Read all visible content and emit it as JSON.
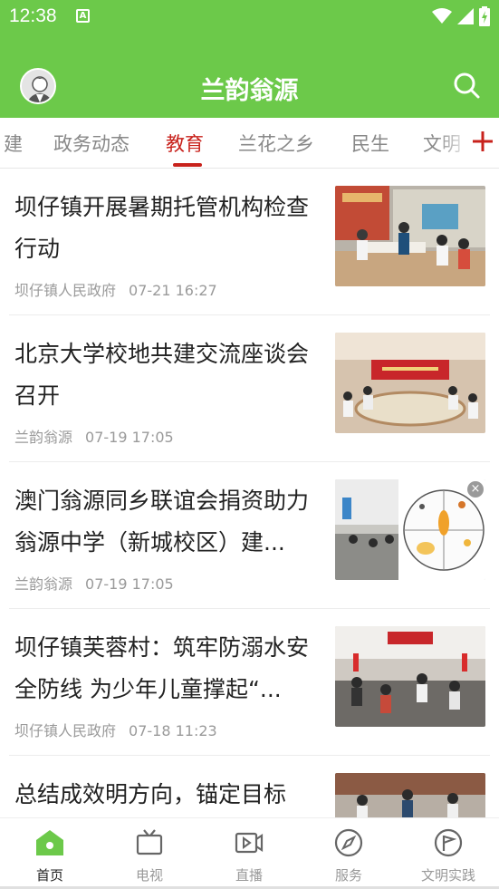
{
  "status": {
    "time": "12:38",
    "indicator": "A"
  },
  "header": {
    "title": "兰韵翁源"
  },
  "tabs": [
    {
      "label": "建"
    },
    {
      "label": "政务动态"
    },
    {
      "label": "教育",
      "active": true
    },
    {
      "label": "兰花之乡"
    },
    {
      "label": "民生"
    },
    {
      "label": "文明"
    }
  ],
  "feed": [
    {
      "title": "坝仔镇开展暑期托管机构检查行动",
      "source": "坝仔镇人民政府",
      "time": "07-21 16:27"
    },
    {
      "title": "北京大学校地共建交流座谈会召开",
      "source": "兰韵翁源",
      "time": "07-19 17:05"
    },
    {
      "title": "澳门翁源同乡联谊会捐资助力翁源中学（新城校区）建...",
      "source": "兰韵翁源",
      "time": "07-19 17:05"
    },
    {
      "title": "坝仔镇芙蓉村：筑牢防溺水安全防线 为少年儿童撑起“...",
      "source": "坝仔镇人民政府",
      "time": "07-18 11:23"
    },
    {
      "title": "总结成效明方向，锚定目标",
      "source": "",
      "time": ""
    }
  ],
  "bottom_nav": [
    {
      "label": "首页",
      "icon": "home-icon",
      "active": true
    },
    {
      "label": "电视",
      "icon": "tv-icon"
    },
    {
      "label": "直播",
      "icon": "live-video-icon"
    },
    {
      "label": "服务",
      "icon": "compass-icon"
    },
    {
      "label": "文明实践",
      "icon": "flag-circle-icon"
    }
  ],
  "colors": {
    "brand": "#6cc94a",
    "accent": "#c8221c"
  }
}
